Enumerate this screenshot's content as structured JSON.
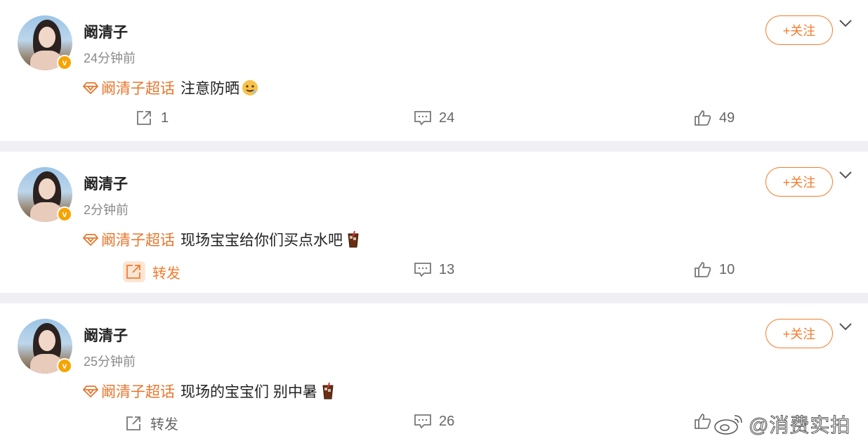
{
  "posts": [
    {
      "username": "阚清子",
      "time": "24分钟前",
      "follow_label": "+关注",
      "topic": "阚清子超话",
      "text": "注意防晒",
      "emoji_icon": "drooling-face-emoji",
      "repost": "1",
      "comments": "24",
      "likes": "49"
    },
    {
      "username": "阚清子",
      "time": "2分钟前",
      "follow_label": "+关注",
      "topic": "阚清子超话",
      "text": "现场宝宝给你们买点水吧",
      "emoji_icon": "iced-drink-emoji",
      "repost": "转发",
      "comments": "13",
      "likes": "10"
    },
    {
      "username": "阚清子",
      "time": "25分钟前",
      "follow_label": "+关注",
      "topic": "阚清子超话",
      "text": "现场的宝宝们 别中暑",
      "emoji_icon": "iced-drink-emoji",
      "repost": "转发",
      "comments": "26",
      "likes": ""
    }
  ],
  "watermark": "@消费实拍",
  "colors": {
    "accent": "#f47c2c",
    "topic": "#e6772e",
    "verified": "#f7a400",
    "background": "#f0eff4"
  }
}
